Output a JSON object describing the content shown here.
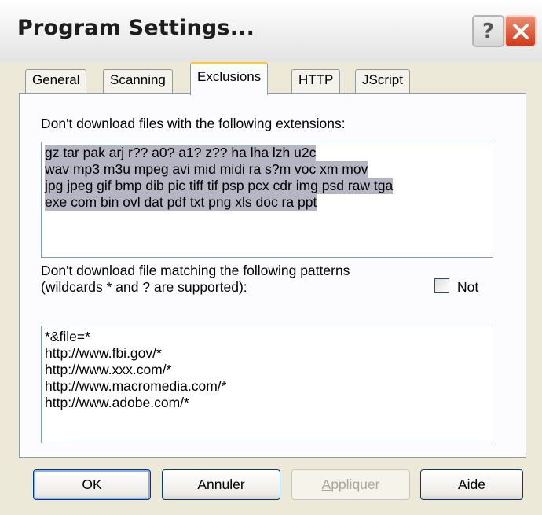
{
  "window": {
    "title": "Program Settings..."
  },
  "tabs": [
    {
      "label": "General"
    },
    {
      "label": "Scanning"
    },
    {
      "label": "Exclusions"
    },
    {
      "label": "HTTP"
    },
    {
      "label": "JScript"
    }
  ],
  "active_tab": "Exclusions",
  "extensions": {
    "label": "Don't download files with the following extensions:",
    "lines": [
      "gz tar pak arj r?? a0? a1? z?? ha lha lzh u2c",
      "wav mp3 m3u mpeg avi mid midi ra s?m voc xm mov",
      "jpg jpeg gif bmp dib pic tiff tif psp pcx cdr img psd raw tga",
      "exe com bin ovl dat pdf txt png xls doc ra ppt"
    ]
  },
  "patterns": {
    "label_line1": "Don't download file matching the following patterns",
    "label_line2": "(wildcards * and ? are supported):",
    "not_label": "Not",
    "not_checked": false,
    "lines": [
      "*&file=*",
      "http://www.fbi.gov/*",
      "http://www.xxx.com/*",
      "http://www.macromedia.com/*",
      "http://www.adobe.com/*"
    ]
  },
  "buttons": {
    "ok": "OK",
    "cancel": "Annuler",
    "apply": "Appliquer",
    "help": "Aide"
  },
  "colors": {
    "active_tab_accent": "#FFC83C",
    "selection": "#B6B5C3",
    "close_button": "#D1391A"
  }
}
